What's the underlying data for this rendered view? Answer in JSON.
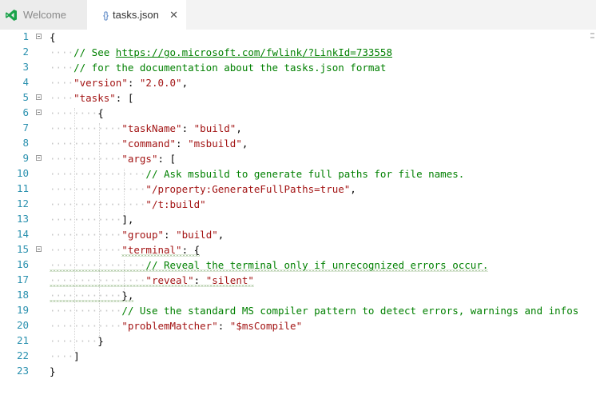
{
  "tabs": [
    {
      "label": "Welcome",
      "icon": "visual-studio-icon",
      "active": false
    },
    {
      "label": "tasks.json",
      "icon": "json-braces-icon",
      "active": true,
      "close": "✕",
      "braces": "{}"
    }
  ],
  "gutter": [
    "1",
    "2",
    "3",
    "4",
    "5",
    "6",
    "7",
    "8",
    "9",
    "10",
    "11",
    "12",
    "13",
    "14",
    "15",
    "16",
    "17",
    "18",
    "19",
    "20",
    "21",
    "22",
    "23"
  ],
  "code": {
    "l1_brace": "{",
    "l2_comment": "// See ",
    "l2_link": "https://go.microsoft.com/fwlink/?LinkId=733558",
    "l3_comment": "// for the documentation about the tasks.json format",
    "l4_key": "\"version\"",
    "l4_colon": ": ",
    "l4_val": "\"2.0.0\"",
    "l4_comma": ",",
    "l5_key": "\"tasks\"",
    "l5_rest": ": [",
    "l6": "{",
    "l7_key": "\"taskName\"",
    "l7_colon": ": ",
    "l7_val": "\"build\"",
    "l7_comma": ",",
    "l8_key": "\"command\"",
    "l8_colon": ": ",
    "l8_val": "\"msbuild\"",
    "l8_comma": ",",
    "l9_key": "\"args\"",
    "l9_rest": ": [",
    "l10_comment": "// Ask msbuild to generate full paths for file names.",
    "l11_val": "\"/property:GenerateFullPaths=true\"",
    "l11_comma": ",",
    "l12_val": "\"/t:build\"",
    "l13": "],",
    "l14_key": "\"group\"",
    "l14_colon": ": ",
    "l14_val": "\"build\"",
    "l14_comma": ",",
    "l15_key": "\"terminal\"",
    "l15_rest": ": {",
    "l16_comment": "// Reveal the terminal only if unrecognized errors occur.",
    "l17_key": "\"reveal\"",
    "l17_colon": ": ",
    "l17_val": "\"silent\"",
    "l18": "},",
    "l19_comment": "// Use the standard MS compiler pattern to detect errors, warnings and infos",
    "l20_key": "\"problemMatcher\"",
    "l20_colon": ": ",
    "l20_val": "\"$msCompile\"",
    "l21": "}",
    "l22": "]",
    "l23": "}"
  },
  "colors": {
    "key": "#a31515",
    "string": "#a31515",
    "comment": "#008000",
    "line_number": "#2b91af",
    "squiggle": "#6a9955"
  }
}
